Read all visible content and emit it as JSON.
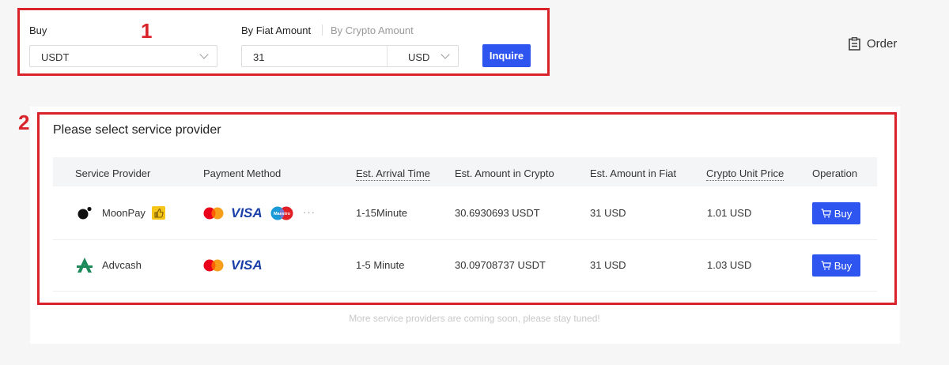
{
  "annotations": {
    "one": "1",
    "two": "2"
  },
  "form": {
    "buy_label": "Buy",
    "crypto_value": "USDT",
    "tab_fiat": "By Fiat Amount",
    "tab_crypto": "By Crypto Amount",
    "amount_value": "31",
    "currency_value": "USD",
    "inquire_label": "Inquire"
  },
  "header": {
    "order_label": "Order"
  },
  "providers": {
    "title": "Please select service provider",
    "columns": [
      "Service Provider",
      "Payment Method",
      "Est. Arrival Time",
      "Est. Amount in Crypto",
      "Est. Amount in Fiat",
      "Crypto Unit Price",
      "Operation"
    ],
    "rows": [
      {
        "name": "MoonPay",
        "payment_icons": [
          "mastercard-icon",
          "visa-icon",
          "maestro-icon",
          "more-icon"
        ],
        "visa_text": "VISA",
        "maestro_text": "Maestro",
        "more_text": "···",
        "arrival": "1-15Minute",
        "crypto": "30.6930693 USDT",
        "fiat": "31 USD",
        "price": "1.01 USD",
        "action": "Buy"
      },
      {
        "name": "Advcash",
        "payment_icons": [
          "mastercard-icon",
          "visa-icon"
        ],
        "visa_text": "VISA",
        "arrival": "1-5 Minute",
        "crypto": "30.09708737 USDT",
        "fiat": "31 USD",
        "price": "1.03 USD",
        "action": "Buy"
      }
    ],
    "footnote": "More service providers are coming soon, please stay tuned!"
  },
  "colors": {
    "accent": "#2e55f0",
    "annotation": "#d9222a",
    "thumb_badge": "#f5c518"
  }
}
